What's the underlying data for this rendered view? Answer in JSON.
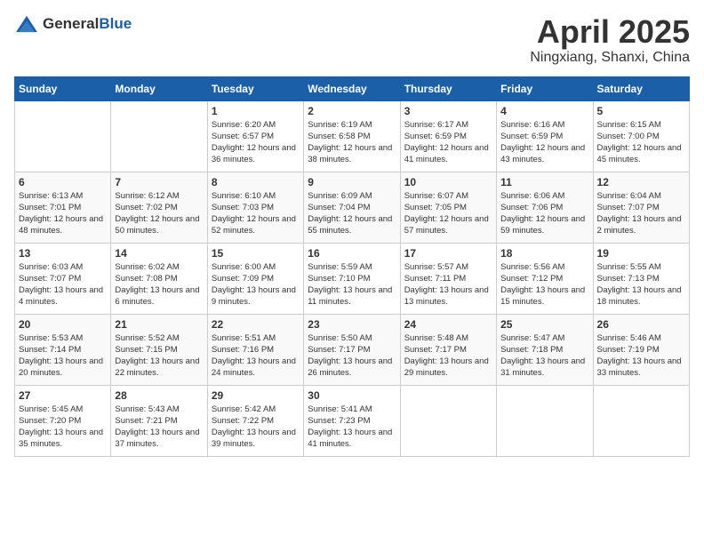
{
  "header": {
    "logo_general": "General",
    "logo_blue": "Blue",
    "month": "April 2025",
    "location": "Ningxiang, Shanxi, China"
  },
  "weekdays": [
    "Sunday",
    "Monday",
    "Tuesday",
    "Wednesday",
    "Thursday",
    "Friday",
    "Saturday"
  ],
  "weeks": [
    [
      {
        "day": "",
        "sunrise": "",
        "sunset": "",
        "daylight": ""
      },
      {
        "day": "",
        "sunrise": "",
        "sunset": "",
        "daylight": ""
      },
      {
        "day": "1",
        "sunrise": "Sunrise: 6:20 AM",
        "sunset": "Sunset: 6:57 PM",
        "daylight": "Daylight: 12 hours and 36 minutes."
      },
      {
        "day": "2",
        "sunrise": "Sunrise: 6:19 AM",
        "sunset": "Sunset: 6:58 PM",
        "daylight": "Daylight: 12 hours and 38 minutes."
      },
      {
        "day": "3",
        "sunrise": "Sunrise: 6:17 AM",
        "sunset": "Sunset: 6:59 PM",
        "daylight": "Daylight: 12 hours and 41 minutes."
      },
      {
        "day": "4",
        "sunrise": "Sunrise: 6:16 AM",
        "sunset": "Sunset: 6:59 PM",
        "daylight": "Daylight: 12 hours and 43 minutes."
      },
      {
        "day": "5",
        "sunrise": "Sunrise: 6:15 AM",
        "sunset": "Sunset: 7:00 PM",
        "daylight": "Daylight: 12 hours and 45 minutes."
      }
    ],
    [
      {
        "day": "6",
        "sunrise": "Sunrise: 6:13 AM",
        "sunset": "Sunset: 7:01 PM",
        "daylight": "Daylight: 12 hours and 48 minutes."
      },
      {
        "day": "7",
        "sunrise": "Sunrise: 6:12 AM",
        "sunset": "Sunset: 7:02 PM",
        "daylight": "Daylight: 12 hours and 50 minutes."
      },
      {
        "day": "8",
        "sunrise": "Sunrise: 6:10 AM",
        "sunset": "Sunset: 7:03 PM",
        "daylight": "Daylight: 12 hours and 52 minutes."
      },
      {
        "day": "9",
        "sunrise": "Sunrise: 6:09 AM",
        "sunset": "Sunset: 7:04 PM",
        "daylight": "Daylight: 12 hours and 55 minutes."
      },
      {
        "day": "10",
        "sunrise": "Sunrise: 6:07 AM",
        "sunset": "Sunset: 7:05 PM",
        "daylight": "Daylight: 12 hours and 57 minutes."
      },
      {
        "day": "11",
        "sunrise": "Sunrise: 6:06 AM",
        "sunset": "Sunset: 7:06 PM",
        "daylight": "Daylight: 12 hours and 59 minutes."
      },
      {
        "day": "12",
        "sunrise": "Sunrise: 6:04 AM",
        "sunset": "Sunset: 7:07 PM",
        "daylight": "Daylight: 13 hours and 2 minutes."
      }
    ],
    [
      {
        "day": "13",
        "sunrise": "Sunrise: 6:03 AM",
        "sunset": "Sunset: 7:07 PM",
        "daylight": "Daylight: 13 hours and 4 minutes."
      },
      {
        "day": "14",
        "sunrise": "Sunrise: 6:02 AM",
        "sunset": "Sunset: 7:08 PM",
        "daylight": "Daylight: 13 hours and 6 minutes."
      },
      {
        "day": "15",
        "sunrise": "Sunrise: 6:00 AM",
        "sunset": "Sunset: 7:09 PM",
        "daylight": "Daylight: 13 hours and 9 minutes."
      },
      {
        "day": "16",
        "sunrise": "Sunrise: 5:59 AM",
        "sunset": "Sunset: 7:10 PM",
        "daylight": "Daylight: 13 hours and 11 minutes."
      },
      {
        "day": "17",
        "sunrise": "Sunrise: 5:57 AM",
        "sunset": "Sunset: 7:11 PM",
        "daylight": "Daylight: 13 hours and 13 minutes."
      },
      {
        "day": "18",
        "sunrise": "Sunrise: 5:56 AM",
        "sunset": "Sunset: 7:12 PM",
        "daylight": "Daylight: 13 hours and 15 minutes."
      },
      {
        "day": "19",
        "sunrise": "Sunrise: 5:55 AM",
        "sunset": "Sunset: 7:13 PM",
        "daylight": "Daylight: 13 hours and 18 minutes."
      }
    ],
    [
      {
        "day": "20",
        "sunrise": "Sunrise: 5:53 AM",
        "sunset": "Sunset: 7:14 PM",
        "daylight": "Daylight: 13 hours and 20 minutes."
      },
      {
        "day": "21",
        "sunrise": "Sunrise: 5:52 AM",
        "sunset": "Sunset: 7:15 PM",
        "daylight": "Daylight: 13 hours and 22 minutes."
      },
      {
        "day": "22",
        "sunrise": "Sunrise: 5:51 AM",
        "sunset": "Sunset: 7:16 PM",
        "daylight": "Daylight: 13 hours and 24 minutes."
      },
      {
        "day": "23",
        "sunrise": "Sunrise: 5:50 AM",
        "sunset": "Sunset: 7:17 PM",
        "daylight": "Daylight: 13 hours and 26 minutes."
      },
      {
        "day": "24",
        "sunrise": "Sunrise: 5:48 AM",
        "sunset": "Sunset: 7:17 PM",
        "daylight": "Daylight: 13 hours and 29 minutes."
      },
      {
        "day": "25",
        "sunrise": "Sunrise: 5:47 AM",
        "sunset": "Sunset: 7:18 PM",
        "daylight": "Daylight: 13 hours and 31 minutes."
      },
      {
        "day": "26",
        "sunrise": "Sunrise: 5:46 AM",
        "sunset": "Sunset: 7:19 PM",
        "daylight": "Daylight: 13 hours and 33 minutes."
      }
    ],
    [
      {
        "day": "27",
        "sunrise": "Sunrise: 5:45 AM",
        "sunset": "Sunset: 7:20 PM",
        "daylight": "Daylight: 13 hours and 35 minutes."
      },
      {
        "day": "28",
        "sunrise": "Sunrise: 5:43 AM",
        "sunset": "Sunset: 7:21 PM",
        "daylight": "Daylight: 13 hours and 37 minutes."
      },
      {
        "day": "29",
        "sunrise": "Sunrise: 5:42 AM",
        "sunset": "Sunset: 7:22 PM",
        "daylight": "Daylight: 13 hours and 39 minutes."
      },
      {
        "day": "30",
        "sunrise": "Sunrise: 5:41 AM",
        "sunset": "Sunset: 7:23 PM",
        "daylight": "Daylight: 13 hours and 41 minutes."
      },
      {
        "day": "",
        "sunrise": "",
        "sunset": "",
        "daylight": ""
      },
      {
        "day": "",
        "sunrise": "",
        "sunset": "",
        "daylight": ""
      },
      {
        "day": "",
        "sunrise": "",
        "sunset": "",
        "daylight": ""
      }
    ]
  ]
}
